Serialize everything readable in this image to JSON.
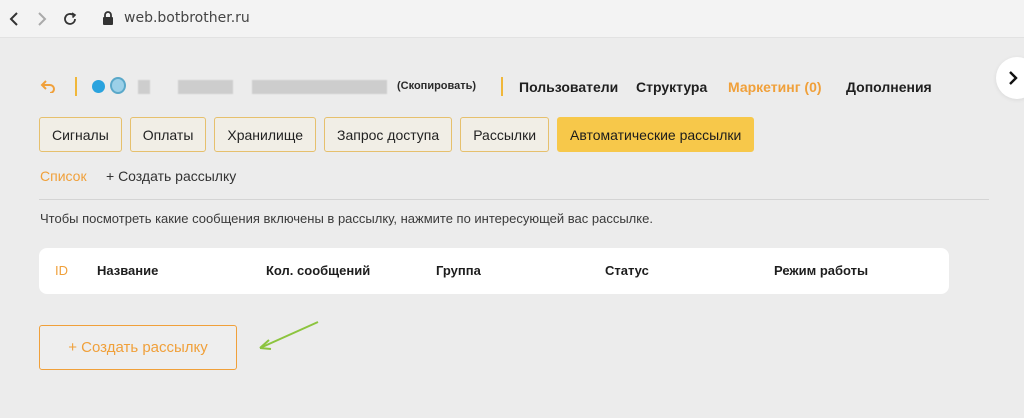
{
  "browser": {
    "url": "web.botbrother.ru"
  },
  "header": {
    "copy_label": "(Скопировать)",
    "nav": [
      {
        "label": "Пользователи",
        "active": false
      },
      {
        "label": "Структура",
        "active": false
      },
      {
        "label": "Маркетинг (0)",
        "active": true
      },
      {
        "label": "Дополнения",
        "active": false
      }
    ]
  },
  "tabs": [
    {
      "label": "Сигналы",
      "active": false
    },
    {
      "label": "Оплаты",
      "active": false
    },
    {
      "label": "Хранилище",
      "active": false
    },
    {
      "label": "Запрос доступа",
      "active": false
    },
    {
      "label": "Рассылки",
      "active": false
    },
    {
      "label": "Автоматические рассылки",
      "active": true
    }
  ],
  "subnav": {
    "list_label": "Список",
    "create_label": "+ Создать рассылку"
  },
  "hint_text": "Чтобы посмотреть какие сообщения включены в рассылку, нажмите по интересующей вас рассылке.",
  "table": {
    "columns": [
      "ID",
      "Название",
      "Кол. сообщений",
      "Группа",
      "Статус",
      "Режим работы"
    ]
  },
  "create_button_label": "+ Создать рассылку",
  "colors": {
    "accent": "#f0a03a",
    "active_tab": "#f7c84a",
    "tab_border": "#e6c06d",
    "background": "#ececec",
    "annotation_arrow": "#8cc43e"
  }
}
